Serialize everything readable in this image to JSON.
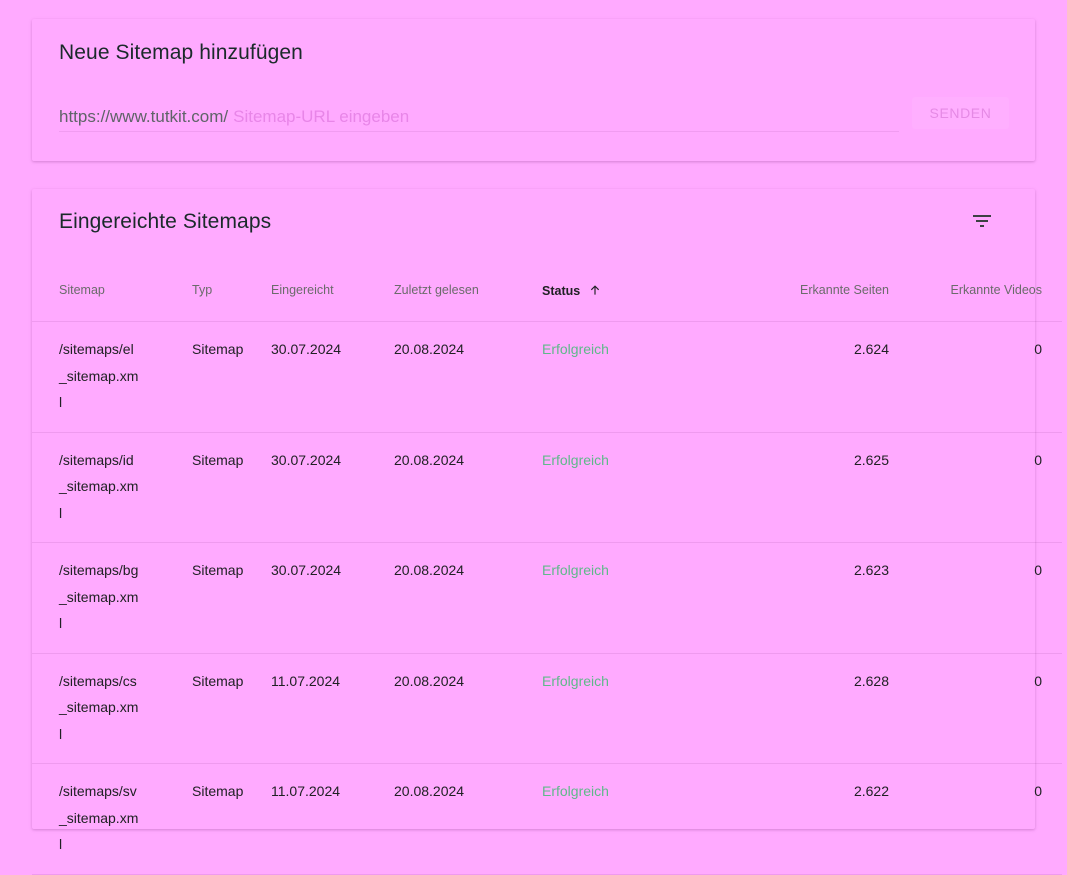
{
  "add_sitemap": {
    "title": "Neue Sitemap hinzufügen",
    "url_prefix": "https://www.tutkit.com/",
    "url_placeholder": "Sitemap-URL eingeben",
    "url_value": "",
    "send_label": "SENDEN"
  },
  "submitted": {
    "title": "Eingereichte Sitemaps",
    "filter_icon": "filter-list-icon",
    "sort_icon": "arrow-up-icon",
    "columns": {
      "sitemap": "Sitemap",
      "typ": "Typ",
      "eingereicht": "Eingereicht",
      "gelesen": "Zuletzt gelesen",
      "status": "Status",
      "seiten": "Erkannte Seiten",
      "videos": "Erkannte Videos"
    },
    "rows": [
      {
        "sitemap": "/sitemaps/el_sitemap.xml",
        "typ": "Sitemap",
        "eingereicht": "30.07.2024",
        "gelesen": "20.08.2024",
        "status": "Erfolgreich",
        "seiten": "2.624",
        "videos": "0"
      },
      {
        "sitemap": "/sitemaps/id_sitemap.xml",
        "typ": "Sitemap",
        "eingereicht": "30.07.2024",
        "gelesen": "20.08.2024",
        "status": "Erfolgreich",
        "seiten": "2.625",
        "videos": "0"
      },
      {
        "sitemap": "/sitemaps/bg_sitemap.xml",
        "typ": "Sitemap",
        "eingereicht": "30.07.2024",
        "gelesen": "20.08.2024",
        "status": "Erfolgreich",
        "seiten": "2.623",
        "videos": "0"
      },
      {
        "sitemap": "/sitemaps/cs_sitemap.xml",
        "typ": "Sitemap",
        "eingereicht": "11.07.2024",
        "gelesen": "20.08.2024",
        "status": "Erfolgreich",
        "seiten": "2.628",
        "videos": "0"
      },
      {
        "sitemap": "/sitemaps/sv_sitemap.xml",
        "typ": "Sitemap",
        "eingereicht": "11.07.2024",
        "gelesen": "20.08.2024",
        "status": "Erfolgreich",
        "seiten": "2.622",
        "videos": "0"
      }
    ]
  },
  "colors": {
    "background": "#ffaaff",
    "status_success": "#5fb98a",
    "muted_accent": "#e58ae5"
  }
}
